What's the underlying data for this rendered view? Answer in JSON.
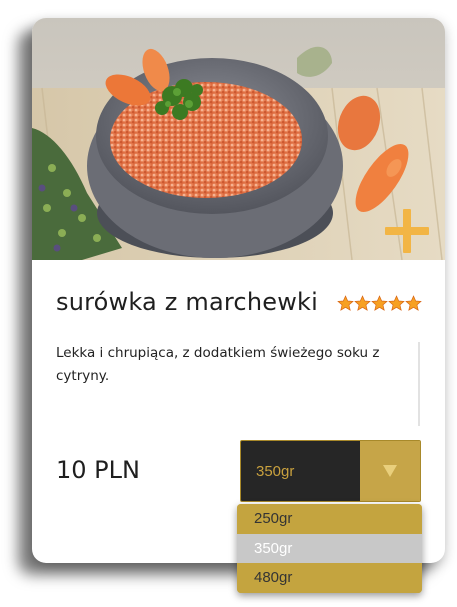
{
  "product": {
    "title": "surówka z marchewki",
    "rating": 5,
    "description": "Lekka i chrupiąca, z dodatkiem świeżego soku z cytryny.",
    "price": "10 PLN"
  },
  "icons": {
    "add": "plus-icon",
    "star": "star-icon",
    "dropdown": "triangle-down-icon"
  },
  "select": {
    "value": "350gr",
    "options": [
      "250gr",
      "350gr",
      "480gr"
    ]
  },
  "colors": {
    "accent": "#f2b545",
    "select_bg": "#262626",
    "select_arrow_bg": "#c6a548",
    "dropdown_bg": "#c4a43f",
    "dropdown_selected_bg": "#c8c8c8"
  }
}
